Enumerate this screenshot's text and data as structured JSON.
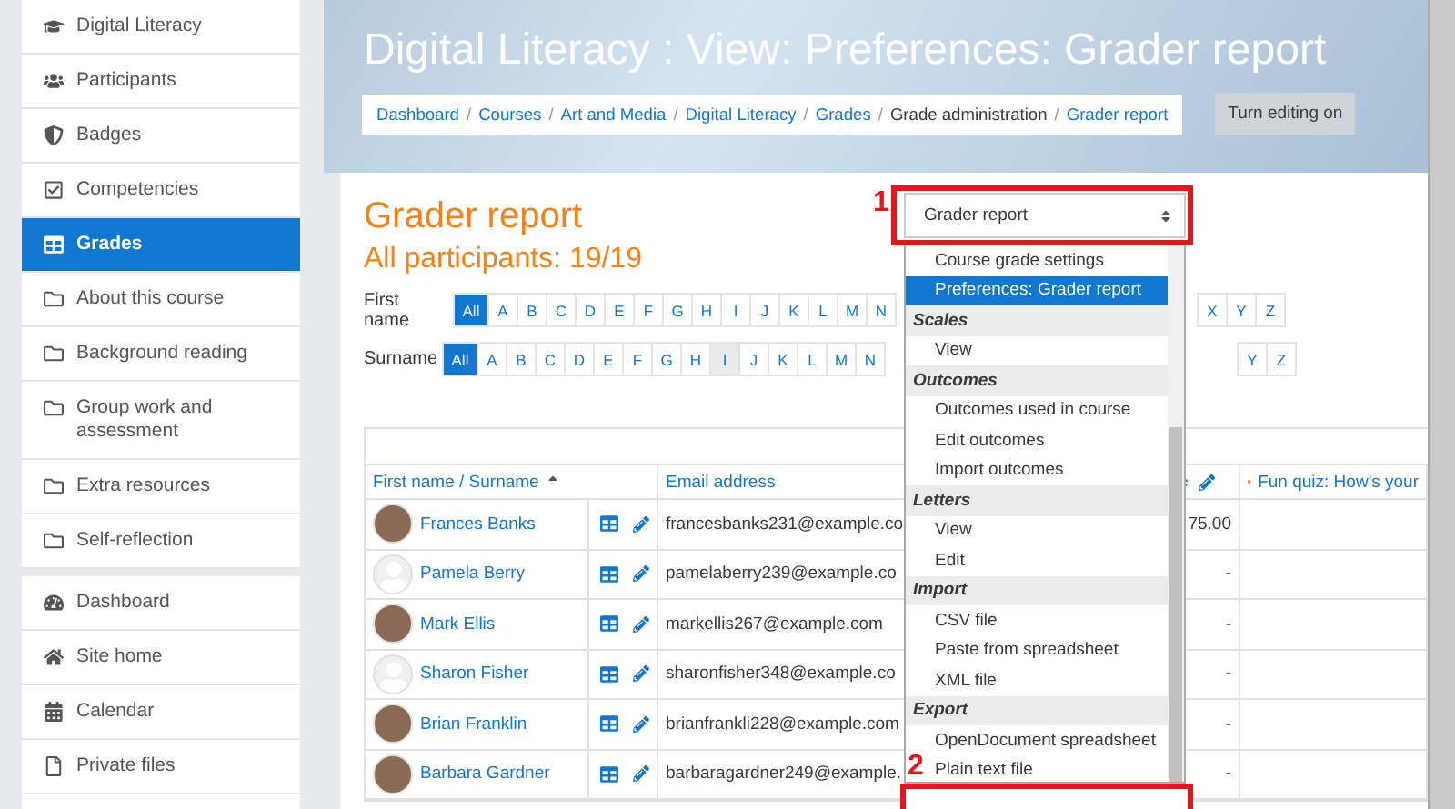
{
  "sidebar": {
    "groups": [
      {
        "items": [
          {
            "kind": "course",
            "label": "Digital Literacy",
            "selected": false
          },
          {
            "kind": "people",
            "label": "Participants",
            "selected": false
          },
          {
            "kind": "badge",
            "label": "Badges",
            "selected": false
          },
          {
            "kind": "competency",
            "label": "Competencies",
            "selected": false
          },
          {
            "kind": "grades",
            "label": "Grades",
            "selected": true
          },
          {
            "kind": "section",
            "label": "About this course",
            "selected": false
          },
          {
            "kind": "section",
            "label": "Background reading",
            "selected": false
          },
          {
            "kind": "section",
            "label": "Group work and assessment",
            "selected": false
          },
          {
            "kind": "section",
            "label": "Extra resources",
            "selected": false
          },
          {
            "kind": "section",
            "label": "Self-reflection",
            "selected": false
          }
        ]
      },
      {
        "items": [
          {
            "kind": "dashboard",
            "label": "Dashboard",
            "selected": false
          },
          {
            "kind": "home",
            "label": "Site home",
            "selected": false
          },
          {
            "kind": "calendar",
            "label": "Calendar",
            "selected": false
          },
          {
            "kind": "file",
            "label": "Private files",
            "selected": false
          }
        ]
      }
    ]
  },
  "header": {
    "title": "Digital Literacy : View: Preferences: Grader report",
    "separator": "/",
    "breadcrumb": [
      {
        "label": "Dashboard",
        "link": true
      },
      {
        "label": "Courses",
        "link": true
      },
      {
        "label": "Art and Media",
        "link": true
      },
      {
        "label": "Digital Literacy",
        "link": true
      },
      {
        "label": "Grades",
        "link": true
      },
      {
        "label": "Grade administration",
        "link": false
      },
      {
        "label": "Grader report",
        "link": true
      }
    ],
    "edit_button": "Turn editing on"
  },
  "report": {
    "title": "Grader report",
    "subtitle": "All participants: 19/19",
    "filters": [
      {
        "label": "First name",
        "letters": [
          {
            "label": "All",
            "selected": true,
            "highlighted": false
          },
          {
            "label": "A",
            "selected": false,
            "highlighted": false
          },
          {
            "label": "B",
            "selected": false,
            "highlighted": false
          },
          {
            "label": "C",
            "selected": false,
            "highlighted": false
          },
          {
            "label": "D",
            "selected": false,
            "highlighted": false
          },
          {
            "label": "E",
            "selected": false,
            "highlighted": false
          },
          {
            "label": "F",
            "selected": false,
            "highlighted": false
          },
          {
            "label": "G",
            "selected": false,
            "highlighted": false
          },
          {
            "label": "H",
            "selected": false,
            "highlighted": false
          },
          {
            "label": "I",
            "selected": false,
            "highlighted": false
          },
          {
            "label": "J",
            "selected": false,
            "highlighted": false
          },
          {
            "label": "K",
            "selected": false,
            "highlighted": false
          },
          {
            "label": "L",
            "selected": false,
            "highlighted": false
          },
          {
            "label": "M",
            "selected": false,
            "highlighted": false
          },
          {
            "label": "N",
            "selected": false,
            "highlighted": false
          }
        ],
        "letters_end": [
          {
            "label": "X",
            "selected": false,
            "highlighted": false
          },
          {
            "label": "Y",
            "selected": false,
            "highlighted": false
          },
          {
            "label": "Z",
            "selected": false,
            "highlighted": false
          }
        ]
      },
      {
        "label": "Surname",
        "letters": [
          {
            "label": "All",
            "selected": true,
            "highlighted": false
          },
          {
            "label": "A",
            "selected": false,
            "highlighted": false
          },
          {
            "label": "B",
            "selected": false,
            "highlighted": false
          },
          {
            "label": "C",
            "selected": false,
            "highlighted": false
          },
          {
            "label": "D",
            "selected": false,
            "highlighted": false
          },
          {
            "label": "E",
            "selected": false,
            "highlighted": false
          },
          {
            "label": "F",
            "selected": false,
            "highlighted": false
          },
          {
            "label": "G",
            "selected": false,
            "highlighted": false
          },
          {
            "label": "H",
            "selected": false,
            "highlighted": false
          },
          {
            "label": "I",
            "selected": false,
            "highlighted": true
          },
          {
            "label": "J",
            "selected": false,
            "highlighted": false
          },
          {
            "label": "K",
            "selected": false,
            "highlighted": false
          },
          {
            "label": "L",
            "selected": false,
            "highlighted": false
          },
          {
            "label": "M",
            "selected": false,
            "highlighted": false
          },
          {
            "label": "N",
            "selected": false,
            "highlighted": false
          }
        ],
        "letters_end": [
          {
            "label": "Y",
            "selected": false,
            "highlighted": false
          },
          {
            "label": "Z",
            "selected": false,
            "highlighted": false
          }
        ]
      }
    ],
    "table": {
      "columns": {
        "name": "First name / Surname",
        "email": "Email address",
        "quiz": "Fun quiz: How's your"
      },
      "rows": [
        {
          "name": "Frances Banks",
          "photo": true,
          "email": "francesbanks231@example.co",
          "grade": "75.00"
        },
        {
          "name": "Pamela Berry",
          "photo": false,
          "email": "pamelaberry239@example.co",
          "grade": "-"
        },
        {
          "name": "Mark Ellis",
          "photo": true,
          "email": "markellis267@example.com",
          "grade": "-"
        },
        {
          "name": "Sharon Fisher",
          "photo": false,
          "email": "sharonfisher348@example.co",
          "grade": "-"
        },
        {
          "name": "Brian Franklin",
          "photo": true,
          "email": "brianfrankli228@example.com",
          "grade": "-"
        },
        {
          "name": "Barbara Gardner",
          "photo": true,
          "email": "barbaragardner249@example.",
          "grade": "-"
        }
      ]
    }
  },
  "report_menu": {
    "value": "Grader report",
    "options": [
      {
        "kind": "option",
        "label": "Course grade settings",
        "selected": false
      },
      {
        "kind": "option",
        "label": "Preferences: Grader report",
        "selected": true
      },
      {
        "kind": "group",
        "label": "Scales",
        "selected": false
      },
      {
        "kind": "option",
        "label": "View",
        "selected": false
      },
      {
        "kind": "group",
        "label": "Outcomes",
        "selected": false
      },
      {
        "kind": "option",
        "label": "Outcomes used in course",
        "selected": false
      },
      {
        "kind": "option",
        "label": "Edit outcomes",
        "selected": false
      },
      {
        "kind": "option",
        "label": "Import outcomes",
        "selected": false
      },
      {
        "kind": "group",
        "label": "Letters",
        "selected": false
      },
      {
        "kind": "option",
        "label": "View",
        "selected": false
      },
      {
        "kind": "option",
        "label": "Edit",
        "selected": false
      },
      {
        "kind": "group",
        "label": "Import",
        "selected": false
      },
      {
        "kind": "option",
        "label": "CSV file",
        "selected": false
      },
      {
        "kind": "option",
        "label": "Paste from spreadsheet",
        "selected": false
      },
      {
        "kind": "option",
        "label": "XML file",
        "selected": false
      },
      {
        "kind": "group",
        "label": "Export",
        "selected": false
      },
      {
        "kind": "option",
        "label": "OpenDocument spreadsheet",
        "selected": false
      },
      {
        "kind": "option",
        "label": "Plain text file",
        "selected": false
      }
    ]
  },
  "annotations": [
    "1",
    "2"
  ]
}
